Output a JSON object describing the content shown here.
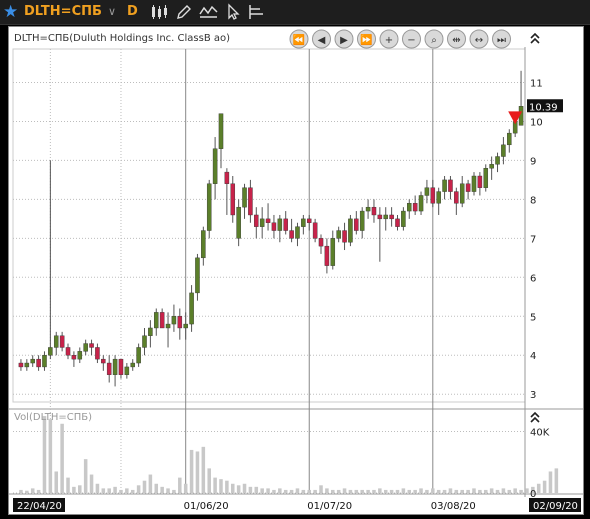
{
  "toolbar": {
    "symbol": "DLTH=СПБ",
    "period": "D",
    "icons": [
      "star-icon",
      "chevron-down-icon",
      "candlestick-icon",
      "pencil-icon",
      "line-style-icon",
      "cursor-icon",
      "crosshair-icon"
    ]
  },
  "nav_buttons": [
    "rewind-icon",
    "step-back-icon",
    "play-icon",
    "fast-forward-icon",
    "zoom-in-icon",
    "zoom-out-icon",
    "zoom-box-icon",
    "pan-horizontal-icon",
    "expand-horizontal-icon",
    "step-forward-icon"
  ],
  "colors": {
    "up": "#5b7f2a",
    "down": "#c7234a",
    "marker": "#e81c1c",
    "background": "#ffffff",
    "grid": "#bdbdbd"
  },
  "chart_data": {
    "type": "candlestick",
    "title": "DLTH=СПБ(Duluth Holdings Inc. ClassB ao)",
    "volume_label": "Vol(DLTH=СПБ)",
    "last_price_label": "10.39",
    "price_ylim": [
      2.8,
      11.5
    ],
    "price_ticks": [
      "3",
      "4",
      "5",
      "6",
      "7",
      "8",
      "9",
      "10",
      "11"
    ],
    "volume_ylim": [
      0,
      52
    ],
    "volume_ticks": [
      {
        "label": "40K",
        "value": 40
      },
      {
        "label": "0",
        "value": 0
      }
    ],
    "x_labels": [
      {
        "label": "22/04/20",
        "index": 0
      },
      {
        "label": "01/06/20",
        "index": 28
      },
      {
        "label": "01/07/20",
        "index": 49
      },
      {
        "label": "03/08/20",
        "index": 70
      },
      {
        "label": "02/09/20",
        "index": 91
      }
    ],
    "candles": [
      [
        3.8,
        3.9,
        3.6,
        3.7
      ],
      [
        3.7,
        3.9,
        3.6,
        3.8
      ],
      [
        3.8,
        4.0,
        3.7,
        3.9
      ],
      [
        3.9,
        4.0,
        3.6,
        3.7
      ],
      [
        3.7,
        4.1,
        3.6,
        4.0
      ],
      [
        4.0,
        9.0,
        3.9,
        4.2
      ],
      [
        4.2,
        4.6,
        4.0,
        4.5
      ],
      [
        4.5,
        4.6,
        4.1,
        4.2
      ],
      [
        4.2,
        4.3,
        3.9,
        4.0
      ],
      [
        4.0,
        4.1,
        3.7,
        3.9
      ],
      [
        3.9,
        4.2,
        3.8,
        4.1
      ],
      [
        4.1,
        4.4,
        4.0,
        4.3
      ],
      [
        4.3,
        4.4,
        4.0,
        4.2
      ],
      [
        4.2,
        4.3,
        3.8,
        3.9
      ],
      [
        3.9,
        4.0,
        3.6,
        3.8
      ],
      [
        3.8,
        4.0,
        3.3,
        3.5
      ],
      [
        3.5,
        4.0,
        3.2,
        3.9
      ],
      [
        3.9,
        3.9,
        3.4,
        3.5
      ],
      [
        3.5,
        3.8,
        3.4,
        3.7
      ],
      [
        3.7,
        3.9,
        3.6,
        3.8
      ],
      [
        3.8,
        4.3,
        3.7,
        4.2
      ],
      [
        4.2,
        4.7,
        4.0,
        4.5
      ],
      [
        4.5,
        4.9,
        4.2,
        4.7
      ],
      [
        4.7,
        5.2,
        4.5,
        5.1
      ],
      [
        5.1,
        5.2,
        4.7,
        4.7
      ],
      [
        4.7,
        5.1,
        4.2,
        4.8
      ],
      [
        4.8,
        5.3,
        4.6,
        5.0
      ],
      [
        5.0,
        5.2,
        4.4,
        4.7
      ],
      [
        4.7,
        5.1,
        4.4,
        4.8
      ],
      [
        4.8,
        5.8,
        4.6,
        5.6
      ],
      [
        5.6,
        6.6,
        5.4,
        6.5
      ],
      [
        6.5,
        7.3,
        6.3,
        7.2
      ],
      [
        7.2,
        8.5,
        7.0,
        8.4
      ],
      [
        8.4,
        9.6,
        8.0,
        9.3
      ],
      [
        9.3,
        10.2,
        8.8,
        10.2
      ],
      [
        8.7,
        8.8,
        7.6,
        8.4
      ],
      [
        8.4,
        8.6,
        7.4,
        7.6
      ],
      [
        7.0,
        8.0,
        6.8,
        7.8
      ],
      [
        7.8,
        8.4,
        7.5,
        8.3
      ],
      [
        8.3,
        8.5,
        7.4,
        7.6
      ],
      [
        7.6,
        7.8,
        7.0,
        7.3
      ],
      [
        7.3,
        7.8,
        7.0,
        7.5
      ],
      [
        7.5,
        7.9,
        7.2,
        7.4
      ],
      [
        7.4,
        7.6,
        7.0,
        7.2
      ],
      [
        7.2,
        7.6,
        6.9,
        7.5
      ],
      [
        7.5,
        7.7,
        7.1,
        7.2
      ],
      [
        7.2,
        7.5,
        6.9,
        7.0
      ],
      [
        7.0,
        7.4,
        6.8,
        7.3
      ],
      [
        7.3,
        7.6,
        7.1,
        7.5
      ],
      [
        7.5,
        7.6,
        7.2,
        7.4
      ],
      [
        7.4,
        7.5,
        6.9,
        7.0
      ],
      [
        7.0,
        7.1,
        6.6,
        6.8
      ],
      [
        6.8,
        7.0,
        6.1,
        6.3
      ],
      [
        6.3,
        7.2,
        6.2,
        7.0
      ],
      [
        7.0,
        7.3,
        6.9,
        7.2
      ],
      [
        7.2,
        7.4,
        6.7,
        6.9
      ],
      [
        6.9,
        7.6,
        6.8,
        7.5
      ],
      [
        7.5,
        7.7,
        7.1,
        7.2
      ],
      [
        7.2,
        7.8,
        7.0,
        7.7
      ],
      [
        7.7,
        8.0,
        7.5,
        7.8
      ],
      [
        7.8,
        8.0,
        7.4,
        7.6
      ],
      [
        7.6,
        7.8,
        6.4,
        7.5
      ],
      [
        7.5,
        7.8,
        7.2,
        7.6
      ],
      [
        7.6,
        7.8,
        7.3,
        7.5
      ],
      [
        7.5,
        7.6,
        7.2,
        7.3
      ],
      [
        7.3,
        7.8,
        7.2,
        7.7
      ],
      [
        7.7,
        8.0,
        7.5,
        7.9
      ],
      [
        7.9,
        8.1,
        7.6,
        7.7
      ],
      [
        7.7,
        8.2,
        7.6,
        8.1
      ],
      [
        8.1,
        8.5,
        7.9,
        8.3
      ],
      [
        8.3,
        8.5,
        7.8,
        7.9
      ],
      [
        7.9,
        8.3,
        7.6,
        8.2
      ],
      [
        8.2,
        8.6,
        8.0,
        8.5
      ],
      [
        8.5,
        8.6,
        8.0,
        8.2
      ],
      [
        8.2,
        8.3,
        7.6,
        7.9
      ],
      [
        7.9,
        8.6,
        7.8,
        8.4
      ],
      [
        8.4,
        8.5,
        8.0,
        8.2
      ],
      [
        8.2,
        8.7,
        8.1,
        8.6
      ],
      [
        8.6,
        8.7,
        8.1,
        8.3
      ],
      [
        8.3,
        8.9,
        8.2,
        8.8
      ],
      [
        8.8,
        9.1,
        8.5,
        8.9
      ],
      [
        8.9,
        9.2,
        8.7,
        9.1
      ],
      [
        9.1,
        9.6,
        8.9,
        9.4
      ],
      [
        9.4,
        9.8,
        9.2,
        9.7
      ],
      [
        9.7,
        10.2,
        9.6,
        10.0
      ],
      [
        9.9,
        11.3,
        9.9,
        10.39
      ]
    ],
    "volume": [
      2,
      1.5,
      3,
      2,
      50,
      48,
      14,
      45,
      10,
      4,
      5,
      22,
      12,
      6,
      3,
      3,
      4,
      2,
      3,
      2,
      5,
      8,
      12,
      6,
      4,
      3,
      2,
      10,
      6,
      28,
      27,
      30,
      16,
      10,
      9,
      8,
      6,
      5,
      6,
      4,
      4,
      3,
      3,
      2,
      3,
      2,
      2,
      3,
      2,
      2,
      2,
      5,
      3,
      2,
      2,
      3,
      2,
      2,
      2,
      2,
      2,
      3,
      2,
      2,
      2,
      3,
      2,
      2,
      3,
      2,
      3,
      2,
      2,
      3,
      2,
      2,
      2,
      3,
      2,
      2,
      3,
      2,
      3,
      2,
      3,
      2,
      3,
      4,
      6,
      8,
      14,
      16
    ]
  }
}
